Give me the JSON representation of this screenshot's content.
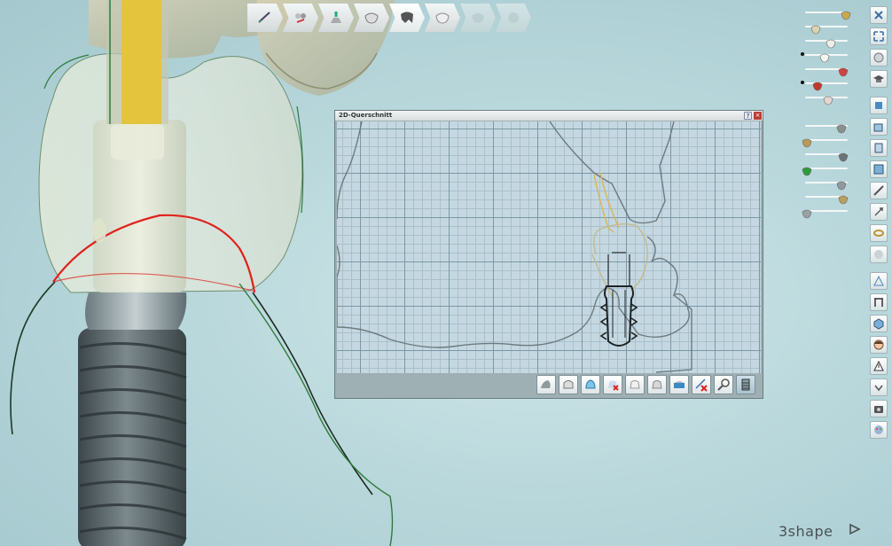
{
  "app": {
    "brand": "3shape"
  },
  "workflow": {
    "steps": [
      {
        "icon": "margin-line-icon",
        "state": "done"
      },
      {
        "icon": "cut-teeth-icon",
        "state": "done"
      },
      {
        "icon": "implant-icon",
        "state": "done"
      },
      {
        "icon": "anatomy-crown-icon",
        "state": "done"
      },
      {
        "icon": "coping-icon",
        "state": "active"
      },
      {
        "icon": "crown-design-icon",
        "state": "next"
      },
      {
        "icon": "crown-finish-icon",
        "state": "disabled"
      },
      {
        "icon": "sphere-icon",
        "state": "disabled"
      }
    ]
  },
  "sliders": [
    {
      "icon": "crown-gold-icon",
      "value": 0.95,
      "dot": false
    },
    {
      "icon": "crown-outline-icon",
      "value": 0.25,
      "dot": false
    },
    {
      "icon": "crown-white-icon",
      "value": 0.6,
      "dot": false
    },
    {
      "icon": "tooth-white-icon",
      "value": 0.45,
      "dot": true
    },
    {
      "icon": "scissors-icon",
      "value": 0.9,
      "dot": false
    },
    {
      "icon": "gingiva-red-icon",
      "value": 0.3,
      "dot": true
    },
    {
      "icon": "tooth-red-icon",
      "value": 0.55,
      "dot": false
    },
    {
      "icon": "pin-icon",
      "value": 0.85,
      "dot": false
    },
    {
      "icon": "implant-small-icon",
      "value": 0.05,
      "dot": false
    },
    {
      "icon": "screw-icon",
      "value": 0.9,
      "dot": false
    },
    {
      "icon": "green-block-icon",
      "value": 0.05,
      "dot": false
    },
    {
      "icon": "drill-icon",
      "value": 0.85,
      "dot": false
    },
    {
      "icon": "abutment-icon",
      "value": 0.9,
      "dot": false
    },
    {
      "icon": "marker-icon",
      "value": 0.05,
      "dot": false
    }
  ],
  "right_tools": [
    "close-view-icon",
    "fullscreen-icon",
    "rotate-view-icon",
    "graduation-cap-icon",
    "separator",
    "view-front-icon",
    "view-top-icon",
    "view-side-icon",
    "view-back-icon",
    "measure-icon",
    "clip-icon",
    "ring-icon",
    "disabled-icon",
    "separator",
    "cross-section-icon",
    "ruler-icon",
    "cube-icon",
    "face-icon",
    "warning-icon",
    "download-icon",
    "camera-icon",
    "palette-icon"
  ],
  "cross_section": {
    "title": "2D-Querschnitt",
    "help_label": "?",
    "close_label": "×",
    "tools": [
      {
        "icon": "gingiva-tool-icon",
        "active": false
      },
      {
        "icon": "tooth-section-icon",
        "active": false
      },
      {
        "icon": "crown-blue-icon",
        "active": false
      },
      {
        "icon": "remove-tooth-icon",
        "active": false
      },
      {
        "icon": "tooth-white-tool-icon",
        "active": false
      },
      {
        "icon": "tooth-gray-tool-icon",
        "active": false
      },
      {
        "icon": "blue-base-icon",
        "active": false
      },
      {
        "icon": "remove-point-icon",
        "active": false
      },
      {
        "icon": "magnifier-icon",
        "active": false
      },
      {
        "icon": "implant-section-icon",
        "active": true
      }
    ]
  },
  "colors": {
    "background": "#b9d8dc",
    "margin_line": "#e0221c",
    "crown_outline": "#2f7a3a",
    "screw_channel": "#e4c43c",
    "implant": "#5f6e73"
  }
}
